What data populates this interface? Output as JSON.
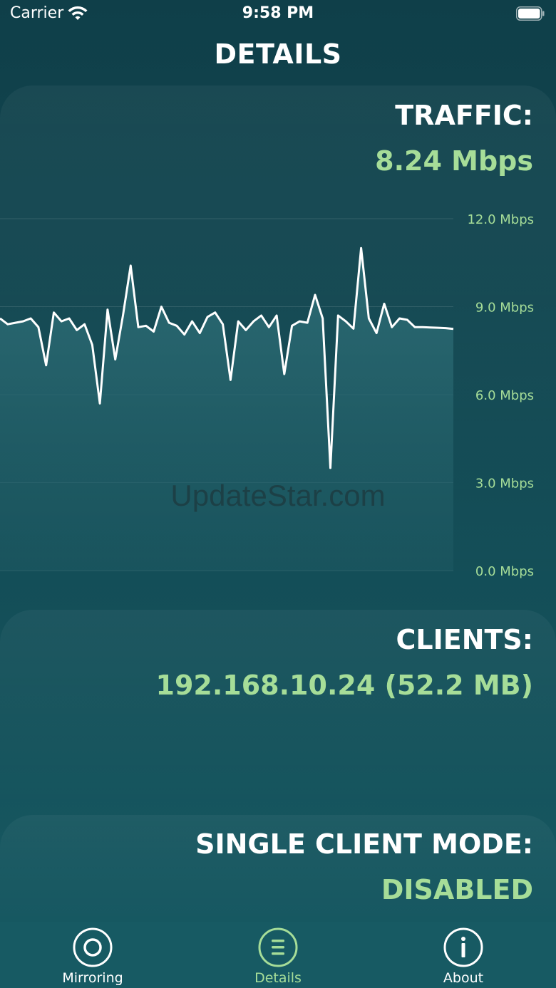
{
  "status_bar": {
    "carrier": "Carrier",
    "time": "9:58 PM"
  },
  "page": {
    "title": "DETAILS"
  },
  "traffic": {
    "label": "TRAFFIC:",
    "value": "8.24 Mbps"
  },
  "clients": {
    "label": "CLIENTS:",
    "value": "192.168.10.24 (52.2 MB)"
  },
  "single_client_mode": {
    "label": "SINGLE CLIENT MODE:",
    "value": "DISABLED"
  },
  "watermark": "UpdateStar.com",
  "colors": {
    "accent_green": "#a6dd98",
    "background": "#124a54",
    "line": "#ffffff"
  },
  "chart_data": {
    "type": "area",
    "ylim": [
      0,
      12
    ],
    "y_ticks": [
      "12.0 Mbps",
      "9.0 Mbps",
      "6.0 Mbps",
      "3.0 Mbps",
      "0.0 Mbps"
    ],
    "y_tick_values": [
      12,
      9,
      6,
      3,
      0
    ],
    "grid": true,
    "values": [
      8.6,
      8.4,
      8.45,
      8.5,
      8.6,
      8.3,
      7.0,
      8.8,
      8.5,
      8.6,
      8.2,
      8.4,
      7.7,
      5.7,
      8.9,
      7.2,
      8.7,
      10.4,
      8.3,
      8.35,
      8.15,
      9.0,
      8.45,
      8.35,
      8.05,
      8.5,
      8.1,
      8.65,
      8.8,
      8.4,
      6.5,
      8.5,
      8.2,
      8.5,
      8.7,
      8.3,
      8.7,
      6.7,
      8.35,
      8.5,
      8.45,
      9.4,
      8.6,
      3.5,
      8.7,
      8.5,
      8.25,
      11.0,
      8.6,
      8.1,
      9.1,
      8.3,
      8.6,
      8.55,
      8.3,
      8.3,
      8.29,
      8.28,
      8.27,
      8.24
    ]
  },
  "tabs": [
    {
      "label": "Mirroring",
      "icon": "record-circle-icon",
      "selected": false
    },
    {
      "label": "Details",
      "icon": "list-circle-icon",
      "selected": true
    },
    {
      "label": "About",
      "icon": "info-circle-icon",
      "selected": false
    }
  ]
}
